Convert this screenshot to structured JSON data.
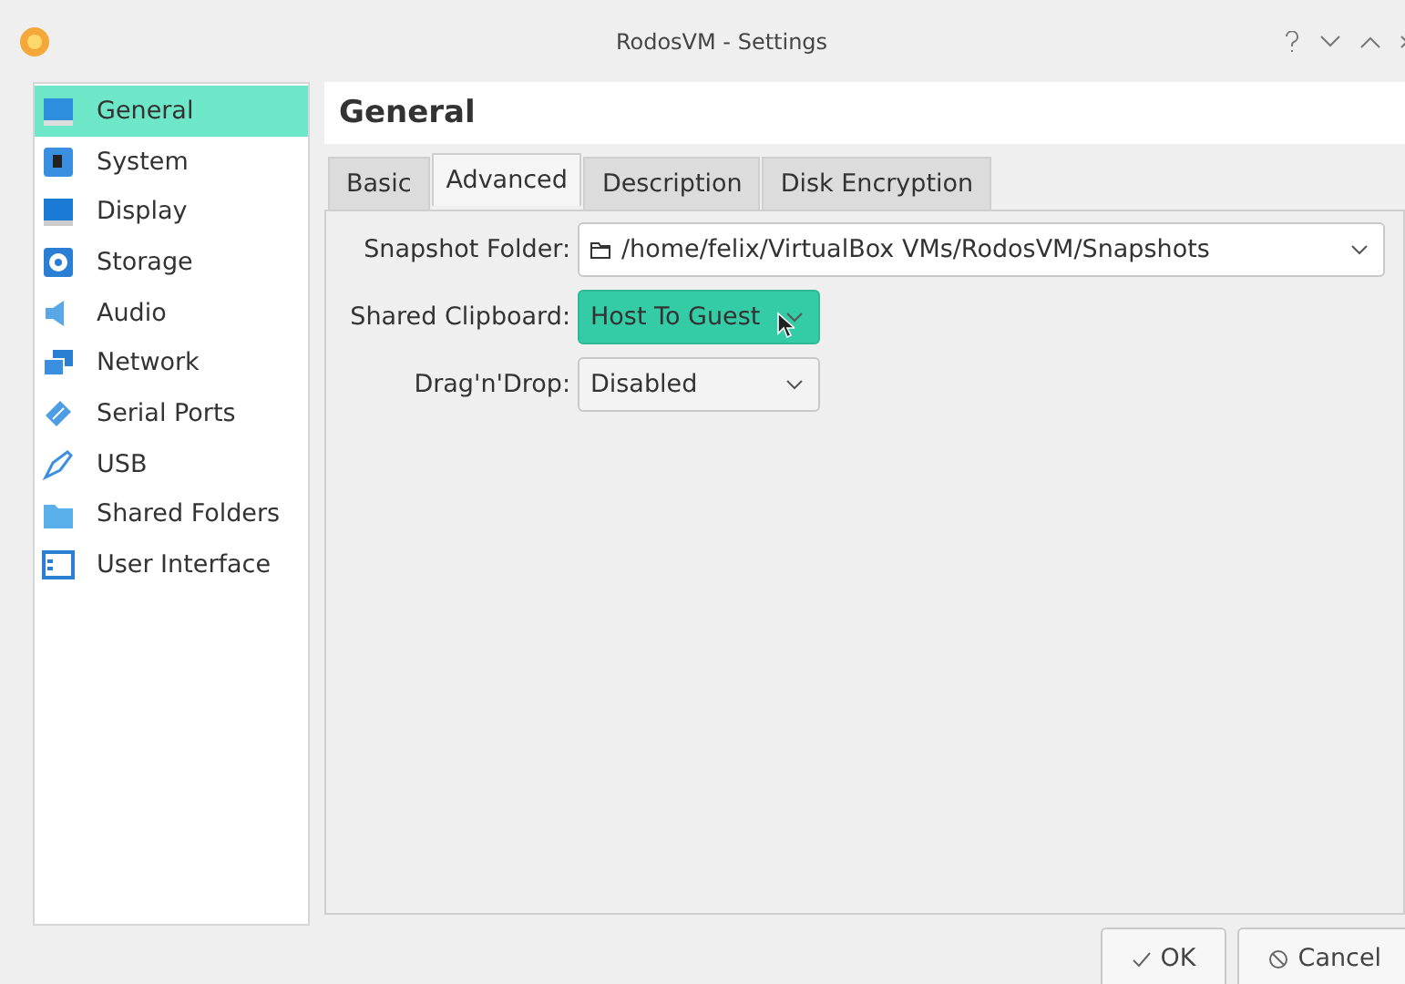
{
  "window": {
    "title": "RodosVM - Settings"
  },
  "sidebar": {
    "items": [
      {
        "label": "General",
        "selected": true
      },
      {
        "label": "System",
        "selected": false
      },
      {
        "label": "Display",
        "selected": false
      },
      {
        "label": "Storage",
        "selected": false
      },
      {
        "label": "Audio",
        "selected": false
      },
      {
        "label": "Network",
        "selected": false
      },
      {
        "label": "Serial Ports",
        "selected": false
      },
      {
        "label": "USB",
        "selected": false
      },
      {
        "label": "Shared Folders",
        "selected": false
      },
      {
        "label": "User Interface",
        "selected": false
      }
    ]
  },
  "page": {
    "title": "General"
  },
  "tabs": [
    {
      "label": "Basic",
      "selected": false
    },
    {
      "label": "Advanced",
      "selected": true
    },
    {
      "label": "Description",
      "selected": false
    },
    {
      "label": "Disk Encryption",
      "selected": false
    }
  ],
  "fields": [
    {
      "label": "Snapshot Folder:",
      "value": "/home/felix/VirtualBox VMs/RodosVM/Snapshots",
      "kind": "folder",
      "highlighted": false
    },
    {
      "label": "Shared Clipboard:",
      "value": "Host To Guest",
      "kind": "combo",
      "highlighted": true
    },
    {
      "label": "Drag'n'Drop:",
      "value": "Disabled",
      "kind": "combo",
      "highlighted": false
    }
  ],
  "buttons": [
    {
      "label": "OK",
      "kind": "ok"
    },
    {
      "label": "Cancel",
      "kind": "cancel"
    }
  ]
}
